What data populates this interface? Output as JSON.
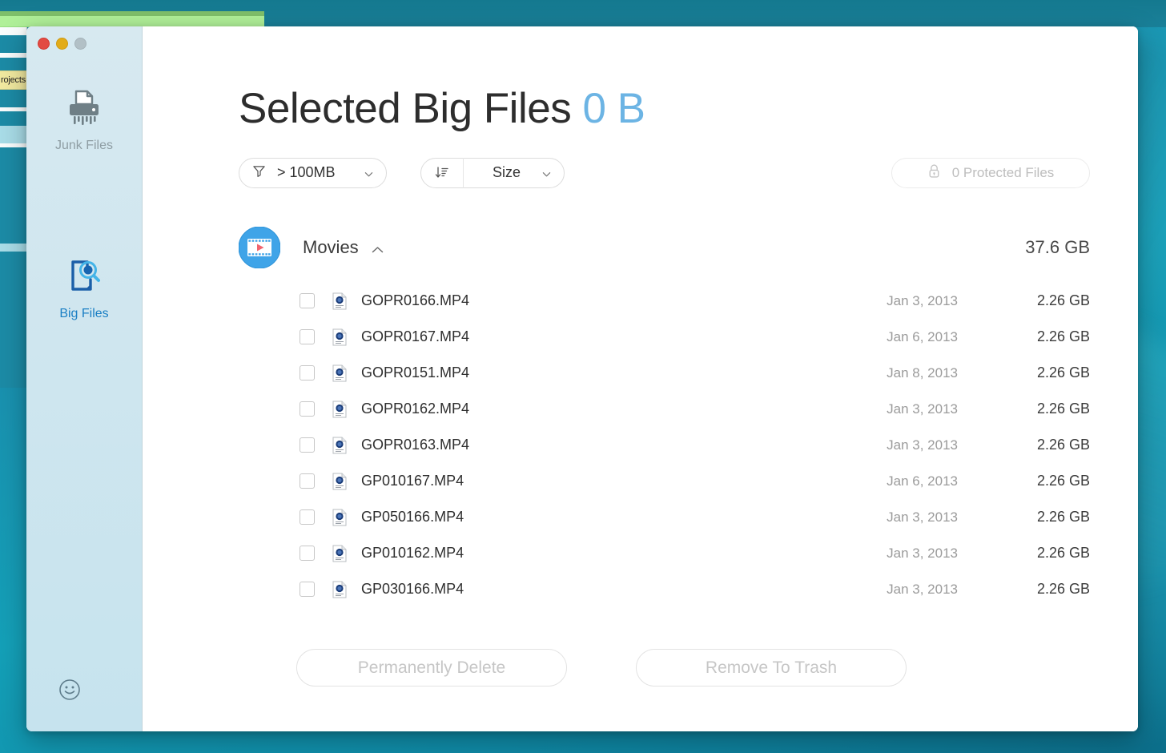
{
  "window": {
    "traffic_lights": [
      "close",
      "minimize",
      "zoom"
    ]
  },
  "background": {
    "finder_label": "rojects"
  },
  "sidebar": {
    "items": [
      {
        "id": "junk-files",
        "label": "Junk Files",
        "icon": "shredder-icon",
        "active": false
      },
      {
        "id": "big-files",
        "label": "Big Files",
        "icon": "document-search-icon",
        "active": true
      }
    ],
    "feedback_icon": "smiley-icon"
  },
  "header": {
    "title": "Selected Big Files",
    "selected_size": "0 B"
  },
  "controls": {
    "filter": {
      "icon": "funnel-icon",
      "value": "> 100MB",
      "caret": "chevron-down-icon"
    },
    "sort": {
      "icon": "sort-descending-icon",
      "value": "Size",
      "caret": "chevron-down-icon"
    },
    "protected": {
      "icon": "lock-icon",
      "label": "0 Protected Files"
    }
  },
  "group": {
    "icon": "movies-icon",
    "name": "Movies",
    "chevron": "chevron-up-icon",
    "size": "37.6 GB"
  },
  "files": [
    {
      "name": "GOPR0166.MP4",
      "date": "Jan 3, 2013",
      "size": "2.26 GB",
      "checked": false
    },
    {
      "name": "GOPR0167.MP4",
      "date": "Jan 6, 2013",
      "size": "2.26 GB",
      "checked": false
    },
    {
      "name": "GOPR0151.MP4",
      "date": "Jan 8, 2013",
      "size": "2.26 GB",
      "checked": false
    },
    {
      "name": "GOPR0162.MP4",
      "date": "Jan 3, 2013",
      "size": "2.26 GB",
      "checked": false
    },
    {
      "name": "GOPR0163.MP4",
      "date": "Jan 3, 2013",
      "size": "2.26 GB",
      "checked": false
    },
    {
      "name": "GP010167.MP4",
      "date": "Jan 6, 2013",
      "size": "2.26 GB",
      "checked": false
    },
    {
      "name": "GP050166.MP4",
      "date": "Jan 3, 2013",
      "size": "2.26 GB",
      "checked": false
    },
    {
      "name": "GP010162.MP4",
      "date": "Jan 3, 2013",
      "size": "2.26 GB",
      "checked": false
    },
    {
      "name": "GP030166.MP4",
      "date": "Jan 3, 2013",
      "size": "2.26 GB",
      "checked": false
    }
  ],
  "footer": {
    "permanently_delete": "Permanently Delete",
    "remove_to_trash": "Remove To Trash"
  },
  "colors": {
    "accent_blue": "#6cb4e4",
    "active_item": "#1b7fc4",
    "inactive_item": "#8f9ea4",
    "sidebar_bg": "#cfe6ef",
    "desktop": "#14a0b8"
  }
}
